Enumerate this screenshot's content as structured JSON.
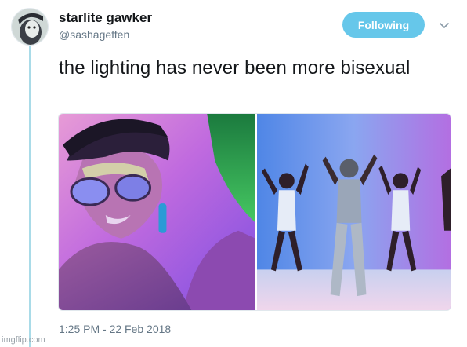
{
  "tweet": {
    "author_name": "starlite gawker",
    "author_handle": "@sashageffen",
    "follow_label": "Following",
    "text": "the lighting has never been more bisexual",
    "timestamp": "1:25 PM - 22 Feb 2018"
  },
  "media": {
    "photos": [
      {
        "name": "photo-left-closeup-sunglasses"
      },
      {
        "name": "photo-right-dancers"
      }
    ]
  },
  "icons": {
    "menu": "chevron-down-icon",
    "avatar": "avatar"
  },
  "colors": {
    "follow_button": "#66c7ea",
    "thread_line": "#a9dbe8",
    "secondary_text": "#657786"
  },
  "watermark": "imgflip.com"
}
